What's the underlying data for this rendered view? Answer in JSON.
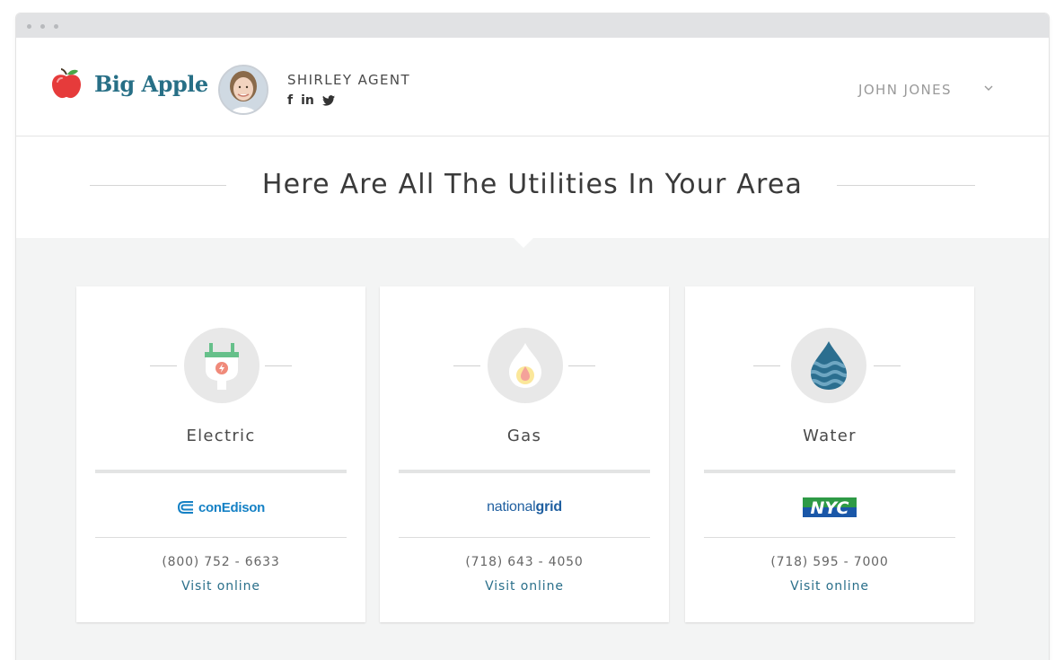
{
  "brand": {
    "name": "Big Apple",
    "color": "#276f86",
    "apple_color": "#e63b3b"
  },
  "agent": {
    "name": "SHIRLEY AGENT",
    "socials": [
      "f",
      "in",
      "twitter"
    ]
  },
  "user": {
    "name": "JOHN JONES"
  },
  "page": {
    "title": "Here Are All The Utilities In Your Area"
  },
  "utilities": [
    {
      "category": "Electric",
      "provider_logo": "conEdison",
      "phone": "(800) 752 - 6633",
      "link": "Visit online",
      "icon": "plug-icon"
    },
    {
      "category": "Gas",
      "provider_logo_a": "national",
      "provider_logo_b": "grid",
      "phone": "(718) 643 - 4050",
      "link": "Visit online",
      "icon": "flame-icon"
    },
    {
      "category": "Water",
      "provider_logo": "NYC",
      "phone": "(718) 595 - 7000",
      "link": "Visit online",
      "icon": "water-drop-icon"
    }
  ],
  "colors": {
    "link": "#2a6f8a",
    "background": "#f3f4f4"
  }
}
